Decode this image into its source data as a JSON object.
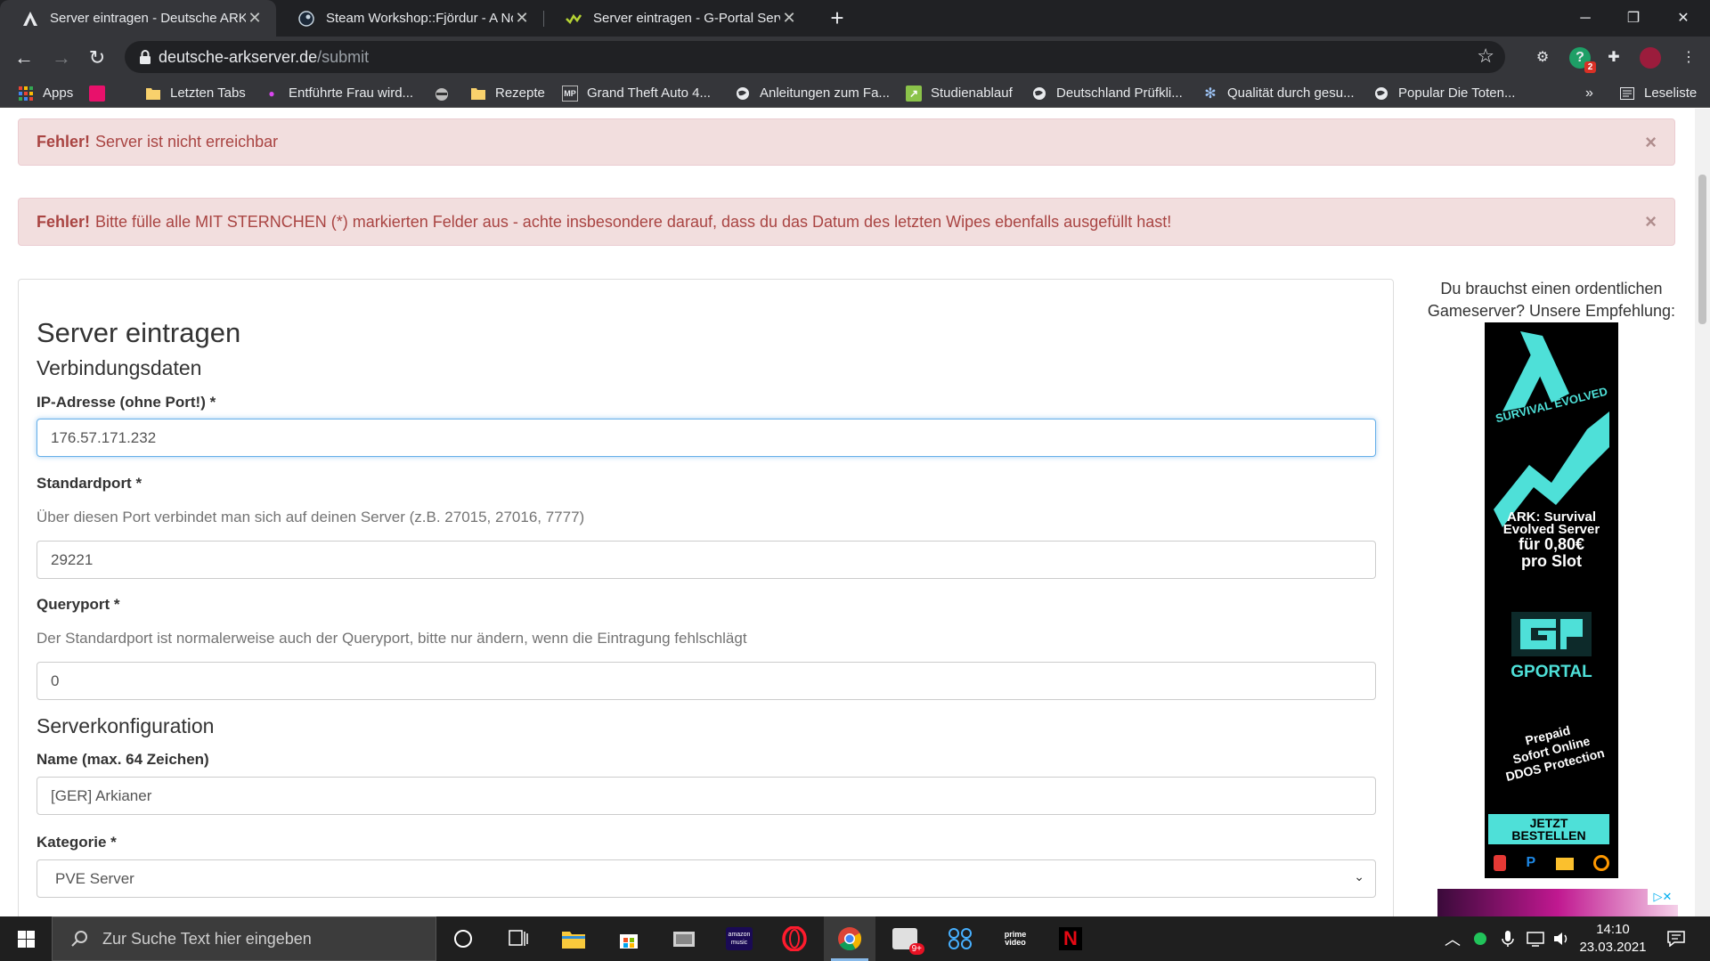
{
  "browser": {
    "tabs": [
      {
        "title": "Server eintragen - Deutsche ARK",
        "icon": "ark-favicon",
        "active": true
      },
      {
        "title": "Steam Workshop::Fjördur - A Nor",
        "icon": "steam-favicon",
        "active": false
      },
      {
        "title": "Server eintragen - G-Portal Serve",
        "icon": "gportal-favicon",
        "active": false
      }
    ],
    "url_domain": "deutsche-arkserver.de",
    "url_path": "/submit",
    "extension_badge": "2",
    "bookmarks": [
      {
        "label": "Apps",
        "icon": "apps-grid-icon"
      },
      {
        "label": "",
        "icon": "pink-site-icon"
      },
      {
        "label": "Letzten Tabs",
        "icon": "folder-icon"
      },
      {
        "label": "Entführte Frau wird...",
        "icon": "site-icon"
      },
      {
        "label": "",
        "icon": "raccoon-icon"
      },
      {
        "label": "Rezepte",
        "icon": "folder-icon"
      },
      {
        "label": "Grand Theft Auto 4...",
        "icon": "mp-icon"
      },
      {
        "label": "Anleitungen zum Fa...",
        "icon": "globe-icon"
      },
      {
        "label": "Studienablauf",
        "icon": "site-icon"
      },
      {
        "label": "Deutschland Prüfkli...",
        "icon": "globe-icon"
      },
      {
        "label": "Qualität durch gesu...",
        "icon": "gear-icon"
      },
      {
        "label": "Popular Die Toten...",
        "icon": "globe-icon"
      }
    ],
    "bookmarks_more": "»",
    "reading_list": "Leseliste"
  },
  "alerts": [
    {
      "strong": "Fehler!",
      "text": "Server ist nicht erreichbar"
    },
    {
      "strong": "Fehler!",
      "text": "Bitte fülle alle MIT STERNCHEN (*) markierten Felder aus - achte insbesondere darauf, dass du das Datum des letzten Wipes ebenfalls ausgefüllt hast!"
    }
  ],
  "form": {
    "title": "Server eintragen",
    "section_connection": "Verbindungsdaten",
    "ip_label": "IP-Adresse (ohne Port!) *",
    "ip_value": "176.57.171.232",
    "port_label": "Standardport *",
    "port_help": "Über diesen Port verbindet man sich auf deinen Server (z.B. 27015, 27016, 7777)",
    "port_value": "29221",
    "query_label": "Queryport *",
    "query_help": "Der Standardport ist normalerweise auch der Queryport, bitte nur ändern, wenn die Eintragung fehlschlägt",
    "query_value": "0",
    "section_config": "Serverkonfiguration",
    "name_label": "Name (max. 64 Zeichen)",
    "name_value": "[GER] Arkianer",
    "category_label": "Kategorie *",
    "category_value": "PVE Server"
  },
  "sidebar": {
    "ad_text": "Du brauchst einen ordentlichen Gameserver? Unsere Empfehlung:",
    "ad_subtitle": "SURVIVAL EVOLVED",
    "ad_headline_1": "ARK: Survival",
    "ad_headline_2": "Evolved Server",
    "ad_headline_3": "für 0,80€",
    "ad_headline_4": "pro Slot",
    "ad_brand": "GPORTAL",
    "ad_features_1": "Prepaid",
    "ad_features_2": "Sofort Online",
    "ad_features_3": "DDOS Protection",
    "ad_cta_1": "JETZT",
    "ad_cta_2": "BESTELLEN"
  },
  "taskbar": {
    "search_placeholder": "Zur Suche Text hier eingeben",
    "time": "14:10",
    "date": "23.03.2021",
    "badge": "9+"
  }
}
